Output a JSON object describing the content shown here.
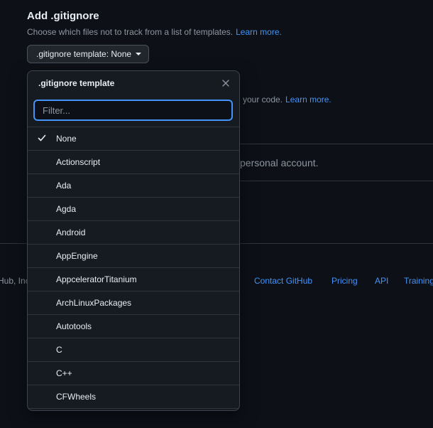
{
  "section": {
    "heading": "Add .gitignore",
    "description": "Choose which files not to track from a list of templates.",
    "learn_more": "Learn more.",
    "template_button": ".gitignore template: None"
  },
  "background": {
    "license_fragment": "your code.",
    "license_learn_more": "Learn more.",
    "account_fragment": "personal account."
  },
  "footer": {
    "left_fragment": "Hub, Inc",
    "links": [
      "Contact GitHub",
      "Pricing",
      "API",
      "Training"
    ]
  },
  "popover": {
    "title": ".gitignore template",
    "filter_placeholder": "Filter...",
    "selected": "None",
    "items": [
      "None",
      "Actionscript",
      "Ada",
      "Agda",
      "Android",
      "AppEngine",
      "AppceleratorTitanium",
      "ArchLinuxPackages",
      "Autotools",
      "C",
      "C++",
      "CFWheels"
    ]
  },
  "colors": {
    "accent": "#4493f8",
    "background": "#0d1117",
    "overlay": "#161b22"
  },
  "icons": {
    "check": "check-icon",
    "close": "close-icon",
    "caret": "caret-down-icon"
  }
}
